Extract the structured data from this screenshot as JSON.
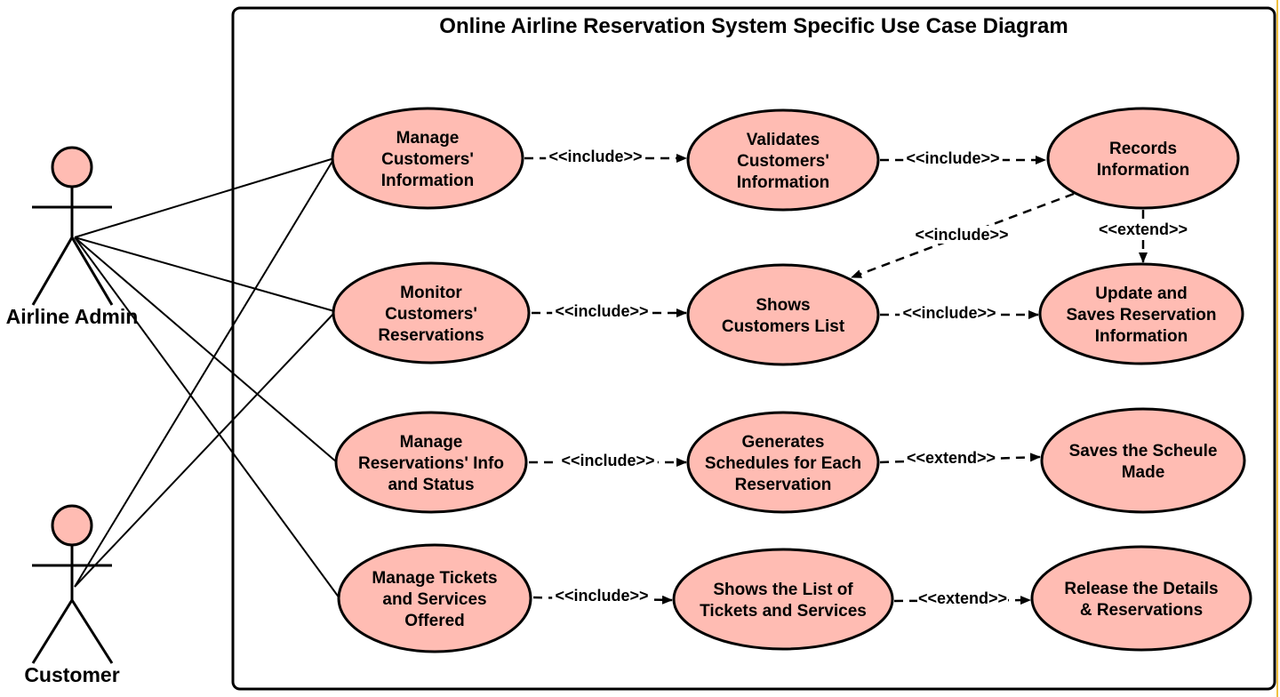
{
  "title": "Online Airline Reservation System Specific Use Case Diagram",
  "colors": {
    "usecase_fill": "#ffbcb3",
    "stroke": "#000000",
    "actor_head_fill": "#ffbcb3",
    "background": "#ffffff"
  },
  "actors": [
    {
      "id": "admin",
      "name": "Airline Admin"
    },
    {
      "id": "customer",
      "name": "Customer"
    }
  ],
  "use_cases": [
    {
      "id": "uc1",
      "lines": [
        "Manage",
        "Customers'",
        "Information"
      ]
    },
    {
      "id": "uc2",
      "lines": [
        "Validates",
        "Customers'",
        "Information"
      ]
    },
    {
      "id": "uc3",
      "lines": [
        "Records",
        "Information"
      ]
    },
    {
      "id": "uc4",
      "lines": [
        "Monitor",
        "Customers'",
        "Reservations"
      ]
    },
    {
      "id": "uc5",
      "lines": [
        "Shows",
        "Customers List"
      ]
    },
    {
      "id": "uc6",
      "lines": [
        "Update and",
        "Saves Reservation",
        "Information"
      ]
    },
    {
      "id": "uc7",
      "lines": [
        "Manage",
        "Reservations' Info",
        "and Status"
      ]
    },
    {
      "id": "uc8",
      "lines": [
        "Generates",
        "Schedules for Each",
        "Reservation"
      ]
    },
    {
      "id": "uc9",
      "lines": [
        "Saves the Scheule",
        "Made"
      ]
    },
    {
      "id": "uc10",
      "lines": [
        "Manage Tickets",
        "and Services",
        "Offered"
      ]
    },
    {
      "id": "uc11",
      "lines": [
        "Shows the List of",
        "Tickets and Services"
      ]
    },
    {
      "id": "uc12",
      "lines": [
        "Release the Details",
        "& Reservations"
      ]
    }
  ],
  "associations": [
    {
      "actor": "admin",
      "use_case": "uc1"
    },
    {
      "actor": "admin",
      "use_case": "uc4"
    },
    {
      "actor": "admin",
      "use_case": "uc7"
    },
    {
      "actor": "admin",
      "use_case": "uc10"
    },
    {
      "actor": "customer",
      "use_case": "uc1"
    },
    {
      "actor": "customer",
      "use_case": "uc4"
    }
  ],
  "relationships": [
    {
      "from": "uc1",
      "to": "uc2",
      "label": "<<include>>"
    },
    {
      "from": "uc2",
      "to": "uc3",
      "label": "<<include>>"
    },
    {
      "from": "uc3",
      "to": "uc5",
      "label": "<<include>>"
    },
    {
      "from": "uc3",
      "to": "uc6",
      "label": "<<extend>>"
    },
    {
      "from": "uc4",
      "to": "uc5",
      "label": "<<include>>"
    },
    {
      "from": "uc5",
      "to": "uc6",
      "label": "<<include>>"
    },
    {
      "from": "uc7",
      "to": "uc8",
      "label": "<<include>>"
    },
    {
      "from": "uc8",
      "to": "uc9",
      "label": "<<extend>>"
    },
    {
      "from": "uc10",
      "to": "uc11",
      "label": "<<include>>"
    },
    {
      "from": "uc11",
      "to": "uc12",
      "label": "<<extend>>"
    }
  ]
}
